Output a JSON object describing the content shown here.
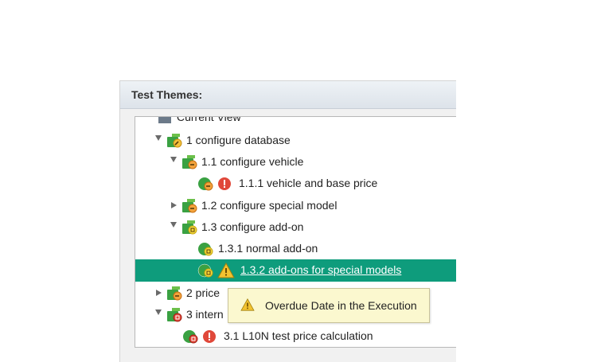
{
  "panel": {
    "title": "Test Themes:"
  },
  "tree": {
    "clipped_label": "Current View",
    "items": [
      {
        "label": "1 configure database",
        "icon": "theme-folder-key-icon",
        "expanded": true
      },
      {
        "label": "1.1 configure vehicle",
        "icon": "theme-folder-hand-icon",
        "expanded": true
      },
      {
        "label": "1.1.1 vehicle and base price",
        "icon": "test-case-hand-icon",
        "status": "error-icon"
      },
      {
        "label": "1.2 configure special model",
        "icon": "theme-folder-hand-icon",
        "expanded": false
      },
      {
        "label": "1.3 configure add-on",
        "icon": "theme-folder-calendar-icon",
        "expanded": true
      },
      {
        "label": "1.3.1 normal add-on",
        "icon": "test-case-calendar-icon"
      },
      {
        "label": "1.3.2 add-ons for special models",
        "icon": "test-case-calendar-icon",
        "status": "warning-icon",
        "selected": true
      },
      {
        "label": "2 price",
        "icon": "theme-folder-hand-icon",
        "expanded": false
      },
      {
        "label": "3 intern",
        "icon": "theme-folder-red-icon",
        "expanded": true
      },
      {
        "label": "3.1 L10N test price calculation",
        "icon": "test-case-red-icon",
        "status": "error-icon"
      }
    ]
  },
  "tooltip": {
    "text": "Overdue Date in the Execution"
  },
  "colors": {
    "selection": "#0e9c7c",
    "tooltip_bg": "#fbf8cf",
    "error": "#e0483a",
    "warning": "#f2c230"
  }
}
